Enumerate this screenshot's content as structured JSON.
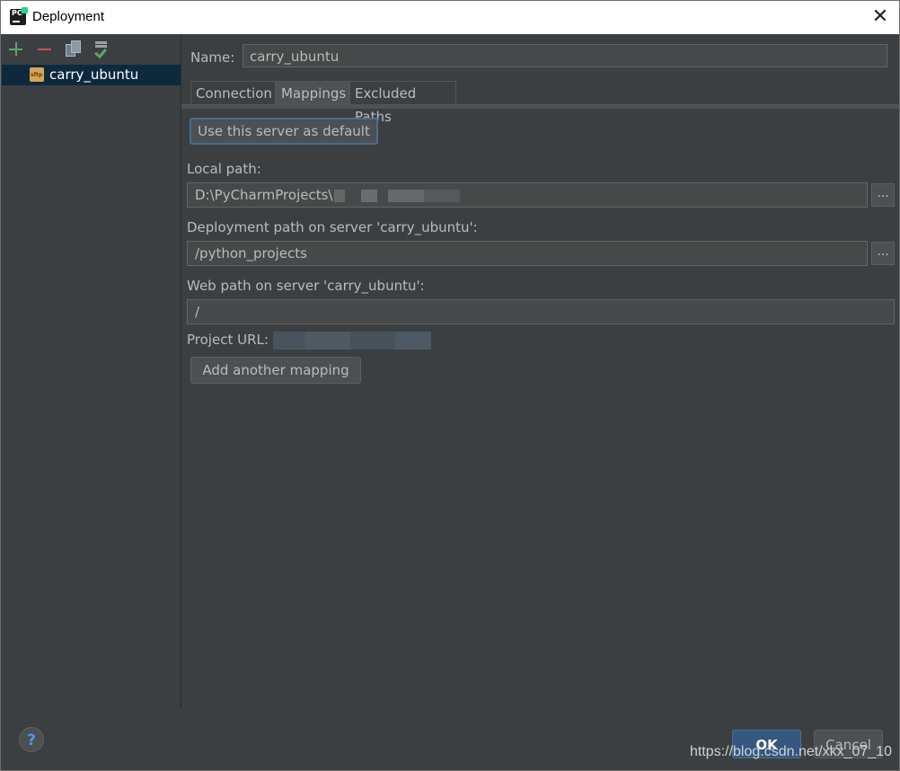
{
  "window": {
    "title": "Deployment",
    "app_icon_text": "PC"
  },
  "sidebar": {
    "servers": [
      {
        "label": "carry_ubuntu",
        "icon": "sftp-icon",
        "icon_text": "sftp"
      }
    ]
  },
  "form": {
    "name_label": "Name:",
    "name_value": "carry_ubuntu",
    "tabs": [
      {
        "label": "Connection"
      },
      {
        "label": "Mappings"
      },
      {
        "label": "Excluded Paths"
      }
    ],
    "default_button": "Use this server as default",
    "local_path_label": "Local path:",
    "local_path_value": "D:\\PyCharmProjects\\",
    "deployment_path_label": "Deployment path on server 'carry_ubuntu':",
    "deployment_path_value": "/python_projects",
    "web_path_label": "Web path on server 'carry_ubuntu':",
    "web_path_value": "/",
    "project_url_label": "Project URL:",
    "add_mapping_button": "Add another mapping",
    "browse_label": "..."
  },
  "footer": {
    "help_label": "?",
    "ok_label": "OK",
    "cancel_label": "Cancel"
  },
  "watermark": "https://blog.csdn.net/xkx_07_10",
  "colors": {
    "background": "#3c3f41",
    "selection": "#0d293e",
    "accent_blue": "#365880",
    "add_green": "#59a869",
    "remove_red": "#c75450"
  }
}
